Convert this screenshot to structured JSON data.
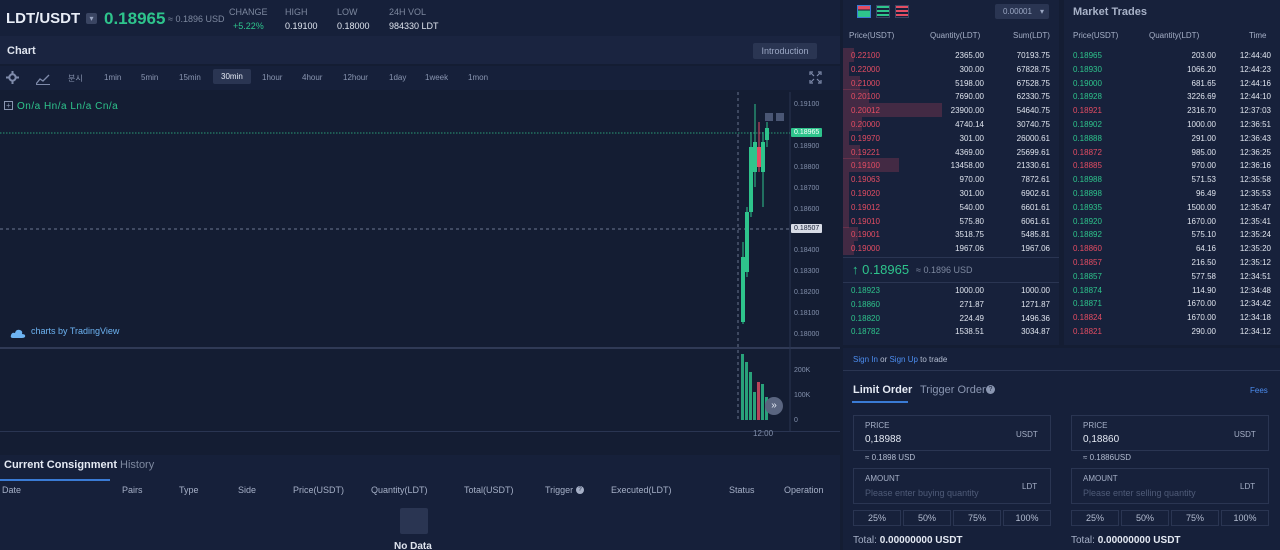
{
  "header": {
    "pair": "LDT/USDT",
    "last_price": "0.18965",
    "last_price_usd": "≈ 0.1896 USD",
    "change_label": "CHANGE",
    "change_value": "+5.22%",
    "high_label": "HIGH",
    "high_value": "0.19100",
    "low_label": "LOW",
    "low_value": "0.18000",
    "vol_label": "24H VOL",
    "vol_value": "984330 LDT"
  },
  "chart": {
    "title": "Chart",
    "intro_button": "Introduction",
    "timeframes": [
      "분시",
      "1min",
      "5min",
      "15min",
      "30min",
      "1hour",
      "4hour",
      "12hour",
      "1day",
      "1week",
      "1mon"
    ],
    "active_timeframe": "30min",
    "ohlc": "On/a  Hn/a  Ln/a  Cn/a",
    "tradingview": "charts by TradingView",
    "price_ticks": [
      "0.19100",
      "0.19000",
      "0.18900",
      "0.18800",
      "0.18700",
      "0.18600",
      "0.18500",
      "0.18400",
      "0.18300",
      "0.18200",
      "0.18100",
      "0.18000"
    ],
    "last_tag": "0.18965",
    "level_tag": "0.18507",
    "volume_ticks": [
      "200K",
      "100K",
      "0"
    ],
    "time_label": "12:00"
  },
  "consignment": {
    "tab_current": "Current Consignment",
    "tab_history": "History",
    "columns": [
      "Date",
      "Pairs",
      "Type",
      "Side",
      "Price(USDT)",
      "Quantity(LDT)",
      "Total(USDT)",
      "Trigger",
      "Executed(LDT)",
      "Status",
      "Operation"
    ],
    "empty_text": "No Data"
  },
  "orderbook": {
    "precision": "0.00001",
    "headers": [
      "Price(USDT)",
      "Quantity(LDT)",
      "Sum(LDT)"
    ],
    "asks": [
      {
        "price": "0.22100",
        "qty": "2365.00",
        "sum": "70193.75",
        "depth": 0.05
      },
      {
        "price": "0.22000",
        "qty": "300.00",
        "sum": "67828.75",
        "depth": 0.03
      },
      {
        "price": "0.21000",
        "qty": "5198.00",
        "sum": "67528.75",
        "depth": 0.08
      },
      {
        "price": "0.20100",
        "qty": "7690.00",
        "sum": "62330.75",
        "depth": 0.12
      },
      {
        "price": "0.20012",
        "qty": "23900.00",
        "sum": "54640.75",
        "depth": 0.46
      },
      {
        "price": "0.20000",
        "qty": "4740.14",
        "sum": "30740.75",
        "depth": 0.09
      },
      {
        "price": "0.19970",
        "qty": "301.00",
        "sum": "26000.61",
        "depth": 0.03
      },
      {
        "price": "0.19221",
        "qty": "4369.00",
        "sum": "25699.61",
        "depth": 0.08
      },
      {
        "price": "0.19100",
        "qty": "13458.00",
        "sum": "21330.61",
        "depth": 0.26
      },
      {
        "price": "0.19063",
        "qty": "970.00",
        "sum": "7872.61",
        "depth": 0.03
      },
      {
        "price": "0.19020",
        "qty": "301.00",
        "sum": "6902.61",
        "depth": 0.03
      },
      {
        "price": "0.19012",
        "qty": "540.00",
        "sum": "6601.61",
        "depth": 0.03
      },
      {
        "price": "0.19010",
        "qty": "575.80",
        "sum": "6061.61",
        "depth": 0.03
      },
      {
        "price": "0.19001",
        "qty": "3518.75",
        "sum": "5485.81",
        "depth": 0.07
      },
      {
        "price": "0.19000",
        "qty": "1967.06",
        "sum": "1967.06",
        "depth": 0.05
      }
    ],
    "mid_price": "↑ 0.18965",
    "mid_usd": "≈ 0.1896 USD",
    "bids": [
      {
        "price": "0.18923",
        "qty": "1000.00",
        "sum": "1000.00"
      },
      {
        "price": "0.18860",
        "qty": "271.87",
        "sum": "1271.87"
      },
      {
        "price": "0.18820",
        "qty": "224.49",
        "sum": "1496.36"
      },
      {
        "price": "0.18782",
        "qty": "1538.51",
        "sum": "3034.87"
      }
    ]
  },
  "market_trades": {
    "title": "Market Trades",
    "headers": [
      "Price(USDT)",
      "Quantity(LDT)",
      "Time"
    ],
    "rows": [
      {
        "price": "0.18965",
        "qty": "203.00",
        "time": "12:44:40",
        "side": "buy"
      },
      {
        "price": "0.18930",
        "qty": "1066.20",
        "time": "12:44:23",
        "side": "buy"
      },
      {
        "price": "0.19000",
        "qty": "681.65",
        "time": "12:44:16",
        "side": "buy"
      },
      {
        "price": "0.18928",
        "qty": "3226.69",
        "time": "12:44:10",
        "side": "buy"
      },
      {
        "price": "0.18921",
        "qty": "2316.70",
        "time": "12:37:03",
        "side": "sell"
      },
      {
        "price": "0.18902",
        "qty": "1000.00",
        "time": "12:36:51",
        "side": "buy"
      },
      {
        "price": "0.18888",
        "qty": "291.00",
        "time": "12:36:43",
        "side": "buy"
      },
      {
        "price": "0.18872",
        "qty": "985.00",
        "time": "12:36:25",
        "side": "sell"
      },
      {
        "price": "0.18885",
        "qty": "970.00",
        "time": "12:36:16",
        "side": "sell"
      },
      {
        "price": "0.18988",
        "qty": "571.53",
        "time": "12:35:58",
        "side": "buy"
      },
      {
        "price": "0.18898",
        "qty": "96.49",
        "time": "12:35:53",
        "side": "buy"
      },
      {
        "price": "0.18935",
        "qty": "1500.00",
        "time": "12:35:47",
        "side": "buy"
      },
      {
        "price": "0.18920",
        "qty": "1670.00",
        "time": "12:35:41",
        "side": "buy"
      },
      {
        "price": "0.18892",
        "qty": "575.10",
        "time": "12:35:24",
        "side": "buy"
      },
      {
        "price": "0.18860",
        "qty": "64.16",
        "time": "12:35:20",
        "side": "sell"
      },
      {
        "price": "0.18857",
        "qty": "216.50",
        "time": "12:35:12",
        "side": "sell"
      },
      {
        "price": "0.18857",
        "qty": "577.58",
        "time": "12:34:51",
        "side": "buy"
      },
      {
        "price": "0.18874",
        "qty": "114.90",
        "time": "12:34:48",
        "side": "buy"
      },
      {
        "price": "0.18871",
        "qty": "1670.00",
        "time": "12:34:42",
        "side": "buy"
      },
      {
        "price": "0.18824",
        "qty": "1670.00",
        "time": "12:34:18",
        "side": "sell"
      },
      {
        "price": "0.18821",
        "qty": "290.00",
        "time": "12:34:12",
        "side": "sell"
      }
    ]
  },
  "order_form": {
    "signin_text": "Sign In",
    "or_text": " or ",
    "signup_text": "Sign Up",
    "to_trade": " to trade",
    "tab_limit": "Limit Order",
    "tab_trigger": "Trigger Order",
    "fees": "Fees",
    "buy": {
      "price_label": "PRICE",
      "price_value": "0,18988",
      "price_unit": "USDT",
      "price_usd": "≈ 0.1898 USD",
      "amount_label": "AMOUNT",
      "amount_placeholder": "Please enter buying quantity",
      "amount_unit": "LDT",
      "total_label": "Total:",
      "total_value": "0.00000000 USDT"
    },
    "sell": {
      "price_label": "PRICE",
      "price_value": "0,18860",
      "price_unit": "USDT",
      "price_usd": "≈ 0.1886USD",
      "amount_label": "AMOUNT",
      "amount_placeholder": "Please enter selling quantity",
      "amount_unit": "LDT",
      "total_label": "Total:",
      "total_value": "0.00000000 USDT"
    },
    "percents": [
      "25%",
      "50%",
      "75%",
      "100%"
    ]
  },
  "colors": {
    "buy": "#2ec48c",
    "sell": "#e44d63",
    "accent": "#3a7bd5",
    "link": "#4c8df0"
  },
  "icons": [
    "chevron-down-icon",
    "gear-icon",
    "indicator-icon",
    "fullscreen-icon",
    "book-both-icon",
    "book-buy-icon",
    "book-sell-icon",
    "help-icon",
    "tradingview-cloud-icon",
    "scroll-right-icon",
    "document-icon",
    "arrow-up-icon"
  ]
}
